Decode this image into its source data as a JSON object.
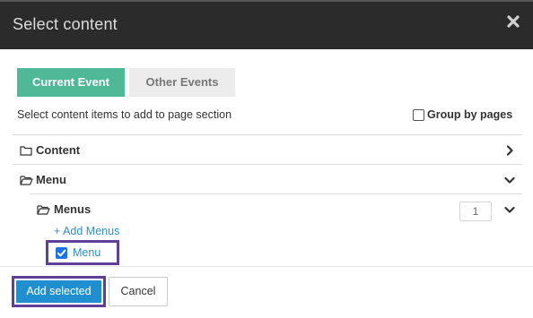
{
  "dialog": {
    "title": "Select content",
    "close_icon": "close-icon"
  },
  "tabs": [
    {
      "label": "Current Event",
      "active": true
    },
    {
      "label": "Other Events",
      "active": false
    }
  ],
  "instructions": "Select content items to add to page section",
  "group_by": {
    "label": "Group by pages",
    "checked": false
  },
  "tree": {
    "content": {
      "label": "Content",
      "icon": "folder-icon",
      "expanded": false
    },
    "menu": {
      "label": "Menu",
      "icon": "folder-open-icon",
      "expanded": true
    },
    "menus": {
      "label": "Menus",
      "icon": "folder-open-icon",
      "expanded": true,
      "count": "1"
    },
    "add_menus": "+ Add Menus",
    "items": [
      {
        "label": "Menu",
        "checked": true
      }
    ]
  },
  "footer": {
    "add_selected": "Add selected",
    "cancel": "Cancel"
  },
  "colors": {
    "header_bg": "#2b2b2b",
    "tab_active": "#4fb896",
    "tab_inactive": "#ececec",
    "primary_button": "#1f8fcf",
    "link": "#2e8fd0",
    "highlight_outline": "#5e3f9a"
  }
}
